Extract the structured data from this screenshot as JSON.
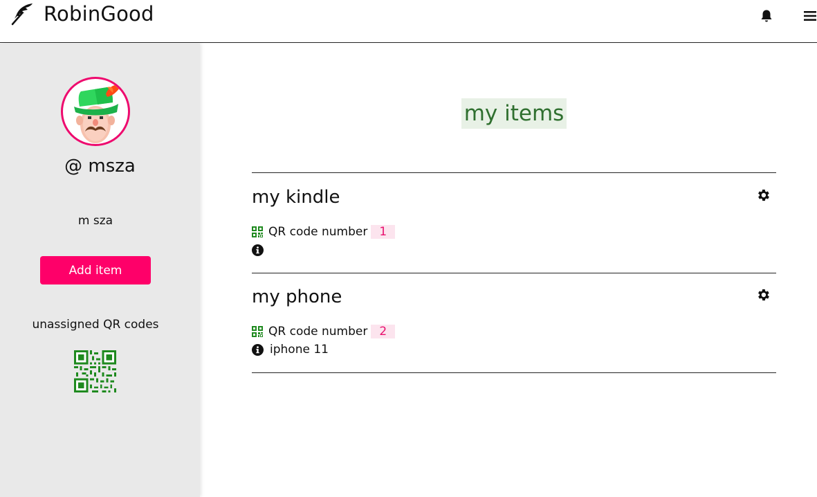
{
  "header": {
    "brand": "RobinGood",
    "icons": {
      "logo": "feather-icon",
      "notifications": "bell-icon",
      "menu": "hamburger-menu-icon"
    }
  },
  "sidebar": {
    "avatar": "robin-hood-avatar",
    "username": "@ msza",
    "fullname": "m sza",
    "add_item_label": "Add item",
    "unassigned_label": "unassigned QR codes",
    "qr_icon": "qr-code-image"
  },
  "main": {
    "title": "my items",
    "items": [
      {
        "title": "my kindle",
        "qr_label": "QR code number",
        "qr_number": "1",
        "info": ""
      },
      {
        "title": "my phone",
        "qr_label": "QR code number",
        "qr_number": "2",
        "info": "iphone 11"
      }
    ]
  },
  "colors": {
    "accent": "#fe0069",
    "avatar_border": "#ee0a6e",
    "title_bg": "#e8f1e6",
    "title_text": "#2f6f2f",
    "qr_green": "#1f8a1f",
    "number_bg": "#fce4ee",
    "number_text": "#e8106e",
    "sidebar_bg": "#e9e9e9"
  }
}
